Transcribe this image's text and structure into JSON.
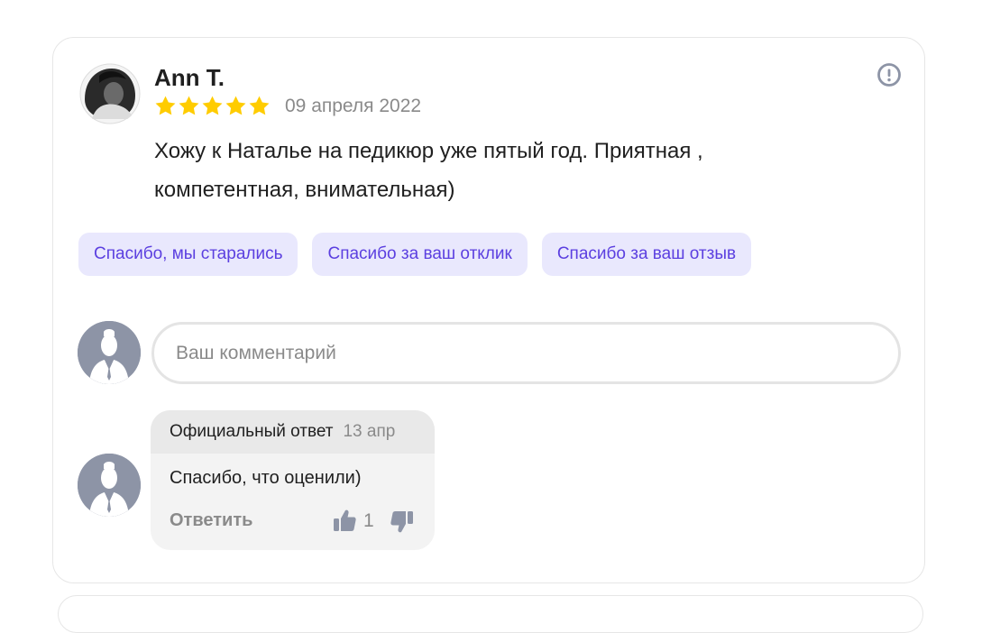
{
  "review": {
    "author": "Ann T.",
    "rating": 5,
    "date": "09 апреля 2022",
    "text": "Хожу к Наталье на педикюр уже пятый год. Приятная , компетентная, внимательная)"
  },
  "quick_replies": [
    "Спасибо, мы старались",
    "Спасибо за ваш отклик",
    "Спасибо за ваш отзыв"
  ],
  "comment": {
    "placeholder": "Ваш комментарий"
  },
  "official_reply": {
    "label": "Официальный ответ",
    "date": "13 апр",
    "text": "Спасибо, что оценили)",
    "reply_action": "Ответить",
    "likes": "1"
  },
  "icons": {
    "report": "exclamation-circle-icon",
    "star": "star-icon",
    "like": "thumbs-up-icon",
    "dislike": "thumbs-down-icon"
  },
  "colors": {
    "star": "#ffcc00",
    "chip_bg": "#e9e8fd",
    "chip_text": "#5b3fe0",
    "muted": "#8a8a8a",
    "avatar_placeholder": "#8d94a6"
  }
}
